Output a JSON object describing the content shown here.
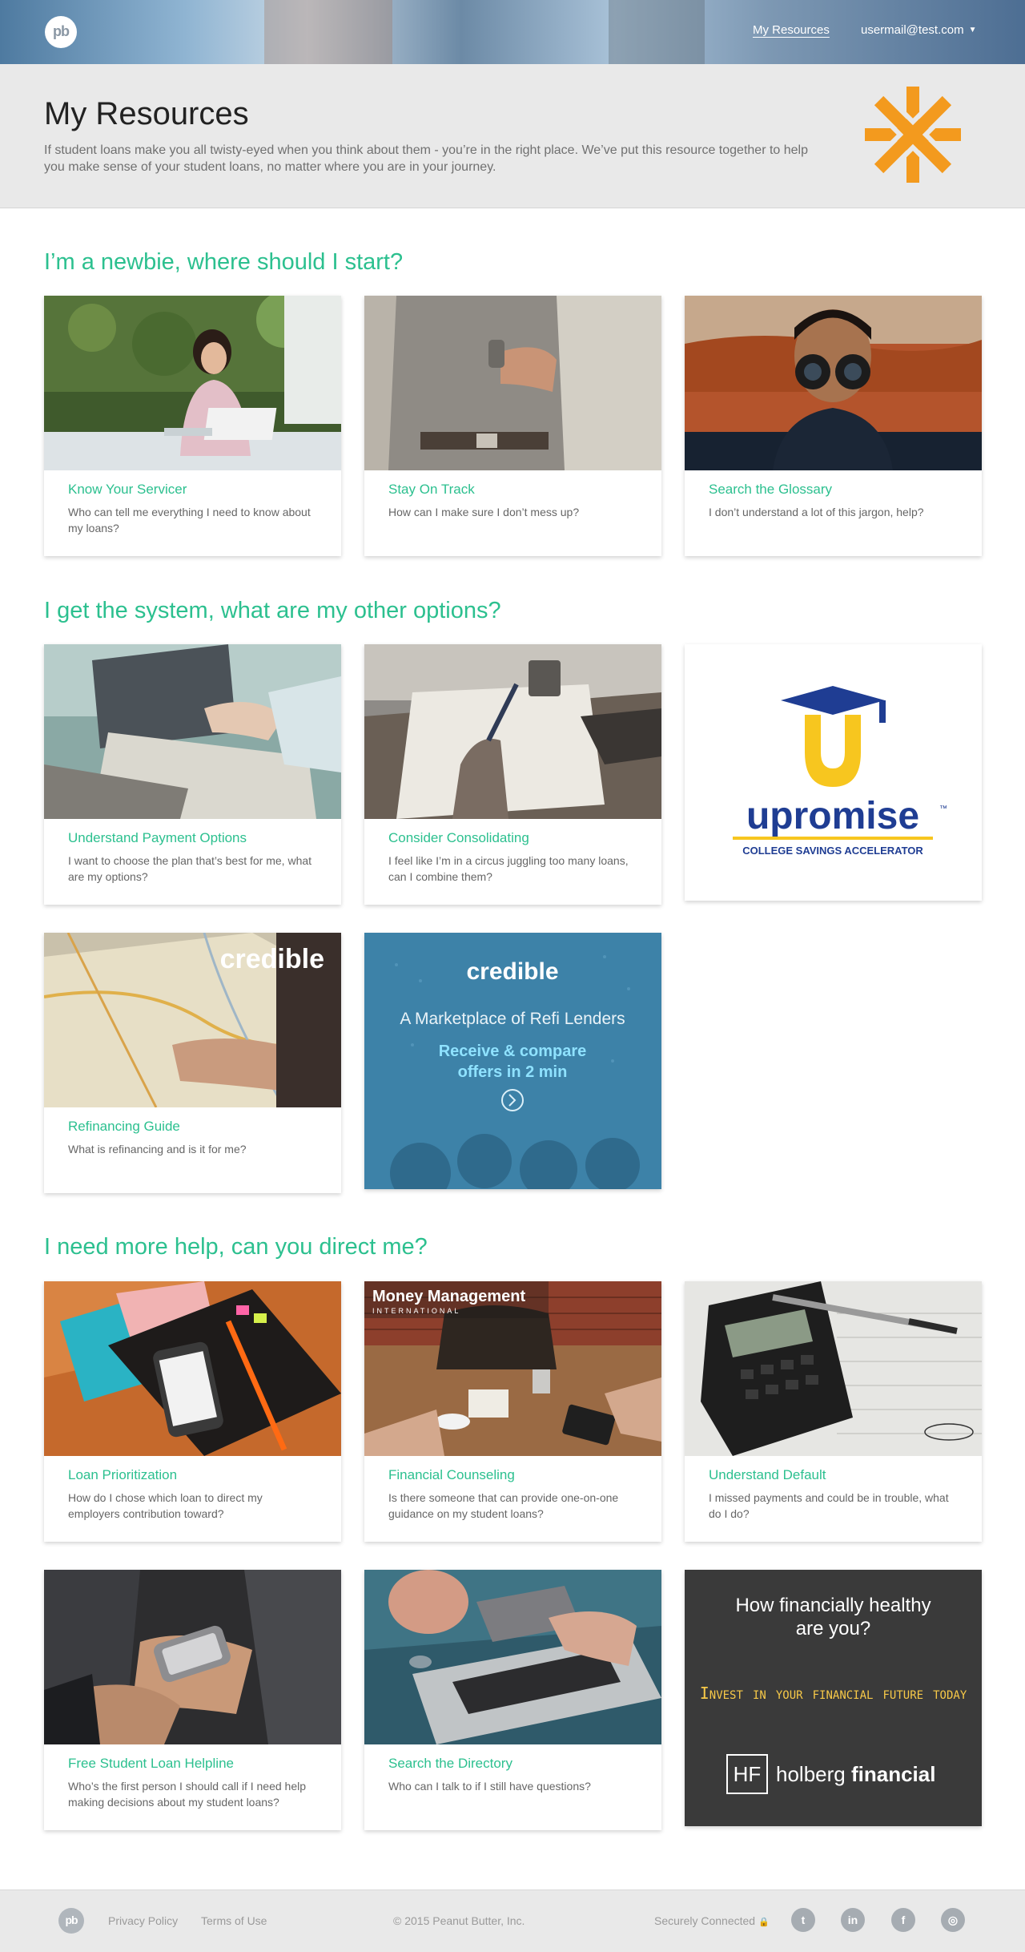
{
  "nav": {
    "logo": "pb",
    "my_resources": "My Resources",
    "user_email": "usermail@test.com"
  },
  "hero": {
    "title": "My Resources",
    "description": "If student loans make you all twisty-eyed when you think about them - you’re in the right place. We’ve put this resource together to help you make sense of your student loans, no matter where you are in your journey."
  },
  "sections": [
    {
      "title": "I’m a newbie, where should I start?",
      "cards": [
        {
          "title": "Know Your Servicer",
          "desc": "Who can tell me everything I need to know about my loans?"
        },
        {
          "title": "Stay On Track",
          "desc": "How can I make sure I don’t mess up?"
        },
        {
          "title": "Search the Glossary",
          "desc": "I don’t understand a lot of this jargon, help?"
        }
      ]
    },
    {
      "title": "I get the system, what are my other options?",
      "cards": [
        {
          "title": "Understand Payment Options",
          "desc": "I want to choose the plan that’s best for me, what are my options?"
        },
        {
          "title": "Consider Consolidating",
          "desc": "I feel like I’m in a circus juggling too many loans, can I combine them?"
        },
        {
          "title": "Refinancing Guide",
          "desc": "What is refinancing and is it for me?"
        }
      ]
    },
    {
      "title": "I need more help, can you direct me?",
      "cards": [
        {
          "title": "Loan Prioritization",
          "desc": "How do I chose which loan to direct my employers contribution toward?"
        },
        {
          "title": "Financial Counseling",
          "desc": "Is there someone that can provide one-on-one guidance on my student loans?"
        },
        {
          "title": "Understand Default",
          "desc": "I missed payments and could be in trouble, what do I do?"
        },
        {
          "title": "Free Student Loan Helpline",
          "desc": "Who’s the first person I should call if I need help making decisions about my student loans?"
        },
        {
          "title": "Search the Directory",
          "desc": "Who can I talk to if I still have questions?"
        }
      ]
    }
  ],
  "ads": {
    "upromise": {
      "name": "upromise",
      "tm": "™",
      "tagline": "COLLEGE SAVINGS ACCELERATOR"
    },
    "credible_card": {
      "brand": "credible"
    },
    "credible_ad": {
      "brand": "credible",
      "headline": "A Marketplace of Refi Lenders",
      "sub1": "Receive & compare",
      "sub2": "offers in 2 min"
    },
    "money_mgmt": {
      "name": "Money Management",
      "sub": "INTERNATIONAL"
    },
    "holberg": {
      "question1": "How financially healthy",
      "question2": "are you?",
      "cta": "Invest in your financial future today",
      "hf": "HF",
      "brand1": "holberg",
      "brand2": "financial"
    }
  },
  "footer": {
    "logo": "pb",
    "privacy": "Privacy Policy",
    "terms": "Terms of Use",
    "copyright": "© 2015 Peanut Butter, Inc.",
    "secure": "Securely Connected",
    "social": [
      "twitter-icon",
      "linkedin-icon",
      "facebook-icon",
      "instagram-icon"
    ]
  },
  "colors": {
    "accent": "#2cc08f",
    "brand_orange": "#f39a1e"
  }
}
